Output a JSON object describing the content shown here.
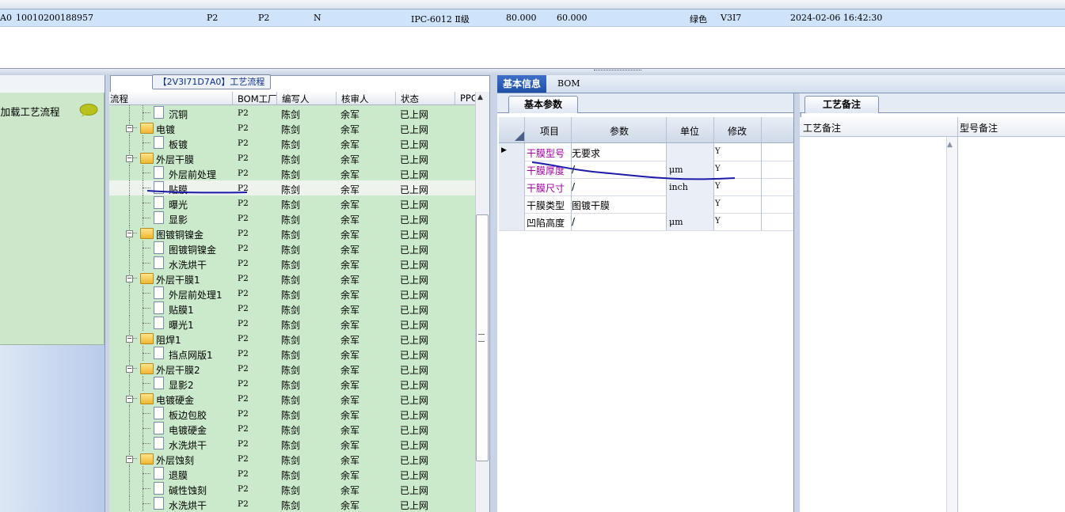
{
  "top_grid": {
    "row": {
      "id_suffix": "A0",
      "order_no": "10010200188957",
      "col_p2a": "P2",
      "col_p2b": "P2",
      "col_n": "N",
      "spec": "IPC-6012 Ⅱ级",
      "val1": "80.000",
      "val2": "60.000",
      "color": "绿色",
      "version": "V3I7",
      "datetime": "2024-02-06 16:42:30"
    }
  },
  "left_panel": {
    "load_text": "添加载工艺流程"
  },
  "tree": {
    "title": "【2V3I71D7A0】工艺流程",
    "headers": {
      "flow": "流程",
      "bom": "BOM工厂",
      "author": "编写人",
      "reviewer": "核审人",
      "status": "状态",
      "ppc": "PPC"
    },
    "rows": [
      {
        "name": "沉铜",
        "level": 2,
        "type": "doc",
        "bom": "P2",
        "author": "陈剑",
        "reviewer": "余军",
        "status": "已上网"
      },
      {
        "name": "电镀",
        "level": 1,
        "type": "folder",
        "bom": "P2",
        "author": "陈剑",
        "reviewer": "余军",
        "status": "已上网"
      },
      {
        "name": "板镀",
        "level": 2,
        "type": "doc",
        "bom": "P2",
        "author": "陈剑",
        "reviewer": "余军",
        "status": "已上网"
      },
      {
        "name": "外层干膜",
        "level": 1,
        "type": "folder",
        "bom": "P2",
        "author": "陈剑",
        "reviewer": "余军",
        "status": "已上网"
      },
      {
        "name": "外层前处理",
        "level": 2,
        "type": "doc",
        "bom": "P2",
        "author": "陈剑",
        "reviewer": "余军",
        "status": "已上网"
      },
      {
        "name": "贴膜",
        "level": 2,
        "type": "doc",
        "bom": "P2",
        "author": "陈剑",
        "reviewer": "余军",
        "status": "已上网",
        "selected": true
      },
      {
        "name": "曝光",
        "level": 2,
        "type": "doc",
        "bom": "P2",
        "author": "陈剑",
        "reviewer": "余军",
        "status": "已上网"
      },
      {
        "name": "显影",
        "level": 2,
        "type": "doc",
        "bom": "P2",
        "author": "陈剑",
        "reviewer": "余军",
        "status": "已上网"
      },
      {
        "name": "图镀铜镍金",
        "level": 1,
        "type": "folder",
        "bom": "P2",
        "author": "陈剑",
        "reviewer": "余军",
        "status": "已上网"
      },
      {
        "name": "图镀铜镍金",
        "level": 2,
        "type": "doc",
        "bom": "P2",
        "author": "陈剑",
        "reviewer": "余军",
        "status": "已上网"
      },
      {
        "name": "水洗烘干",
        "level": 2,
        "type": "doc",
        "bom": "P2",
        "author": "陈剑",
        "reviewer": "余军",
        "status": "已上网"
      },
      {
        "name": "外层干膜1",
        "level": 1,
        "type": "folder",
        "bom": "P2",
        "author": "陈剑",
        "reviewer": "余军",
        "status": "已上网"
      },
      {
        "name": "外层前处理1",
        "level": 2,
        "type": "doc",
        "bom": "P2",
        "author": "陈剑",
        "reviewer": "余军",
        "status": "已上网"
      },
      {
        "name": "贴膜1",
        "level": 2,
        "type": "doc",
        "bom": "P2",
        "author": "陈剑",
        "reviewer": "余军",
        "status": "已上网"
      },
      {
        "name": "曝光1",
        "level": 2,
        "type": "doc",
        "bom": "P2",
        "author": "陈剑",
        "reviewer": "余军",
        "status": "已上网"
      },
      {
        "name": "阻焊1",
        "level": 1,
        "type": "folder",
        "bom": "P2",
        "author": "陈剑",
        "reviewer": "余军",
        "status": "已上网"
      },
      {
        "name": "挡点网版1",
        "level": 2,
        "type": "doc",
        "bom": "P2",
        "author": "陈剑",
        "reviewer": "余军",
        "status": "已上网"
      },
      {
        "name": "外层干膜2",
        "level": 1,
        "type": "folder",
        "bom": "P2",
        "author": "陈剑",
        "reviewer": "余军",
        "status": "已上网"
      },
      {
        "name": "显影2",
        "level": 2,
        "type": "doc",
        "bom": "P2",
        "author": "陈剑",
        "reviewer": "余军",
        "status": "已上网"
      },
      {
        "name": "电镀硬金",
        "level": 1,
        "type": "folder",
        "bom": "P2",
        "author": "陈剑",
        "reviewer": "余军",
        "status": "已上网"
      },
      {
        "name": "板边包胶",
        "level": 2,
        "type": "doc",
        "bom": "P2",
        "author": "陈剑",
        "reviewer": "余军",
        "status": "已上网"
      },
      {
        "name": "电镀硬金",
        "level": 2,
        "type": "doc",
        "bom": "P2",
        "author": "陈剑",
        "reviewer": "余军",
        "status": "已上网"
      },
      {
        "name": "水洗烘干",
        "level": 2,
        "type": "doc",
        "bom": "P2",
        "author": "陈剑",
        "reviewer": "余军",
        "status": "已上网"
      },
      {
        "name": "外层蚀刻",
        "level": 1,
        "type": "folder",
        "bom": "P2",
        "author": "陈剑",
        "reviewer": "余军",
        "status": "已上网"
      },
      {
        "name": "退膜",
        "level": 2,
        "type": "doc",
        "bom": "P2",
        "author": "陈剑",
        "reviewer": "余军",
        "status": "已上网"
      },
      {
        "name": "碱性蚀刻",
        "level": 2,
        "type": "doc",
        "bom": "P2",
        "author": "陈剑",
        "reviewer": "余军",
        "status": "已上网"
      },
      {
        "name": "水洗烘干",
        "level": 2,
        "type": "doc",
        "bom": "P2",
        "author": "陈剑",
        "reviewer": "余军",
        "status": "已上网"
      }
    ]
  },
  "info": {
    "tabs": {
      "basic": "基本信息",
      "bom": "BOM"
    },
    "param_tab": "基本参数",
    "param_headers": {
      "item": "项目",
      "param": "参数",
      "unit": "单位",
      "modify": "修改"
    },
    "params": [
      {
        "item": "干膜型号",
        "param": "无要求",
        "unit": "",
        "modify": "Y",
        "highlight": true,
        "current": true
      },
      {
        "item": "干膜厚度",
        "param": "/",
        "unit": "μm",
        "modify": "Y",
        "highlight": true
      },
      {
        "item": "干膜尺寸",
        "param": "/",
        "unit": "inch",
        "modify": "Y",
        "highlight": true
      },
      {
        "item": "干膜类型",
        "param": "图镀干膜",
        "unit": "",
        "modify": "Y",
        "highlight": false
      },
      {
        "item": "凹陷高度",
        "param": "/",
        "unit": "μm",
        "modify": "Y",
        "highlight": false
      }
    ],
    "notes_tab": "工艺备注",
    "notes_headers": {
      "process": "工艺备注",
      "model": "型号备注"
    }
  },
  "colors": {
    "tree_bg": "#cbe9cb",
    "selected_tab": "#2a5db8",
    "magenta_text": "#a000a0",
    "annotation_ink": "#1c1aa8"
  }
}
